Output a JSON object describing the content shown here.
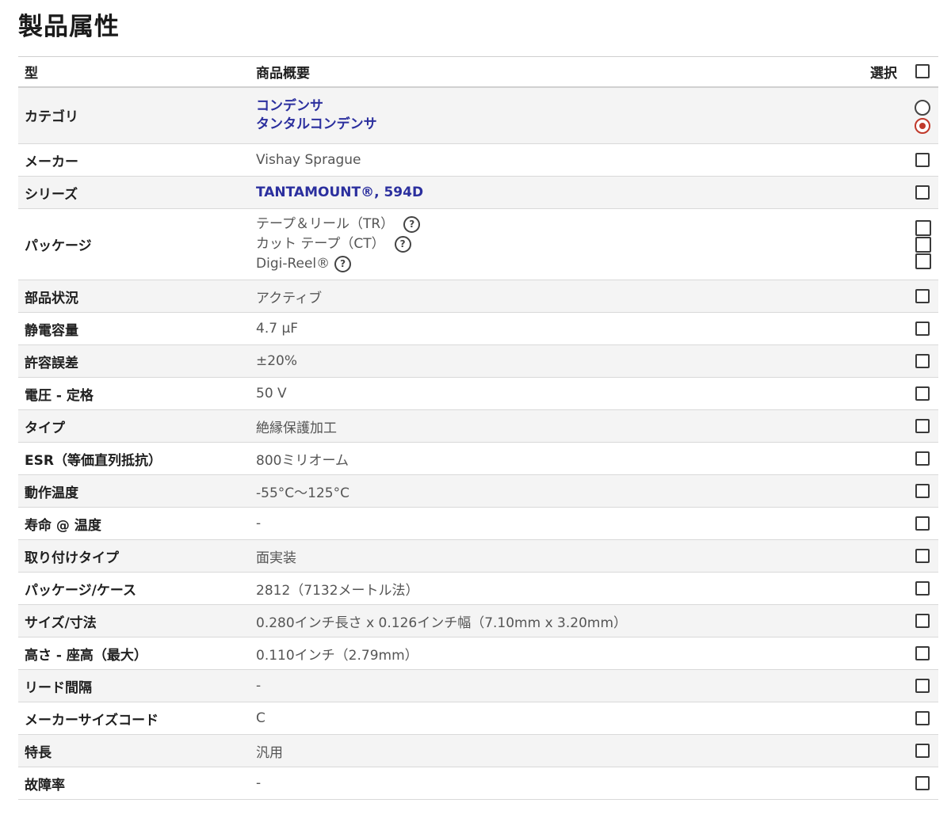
{
  "title": "製品属性",
  "header": {
    "type": "型",
    "summary": "商品概要",
    "select": "選択"
  },
  "category": {
    "label": "カテゴリ",
    "values": [
      "コンデンサ",
      "タンタルコンデンサ"
    ]
  },
  "maker": {
    "label": "メーカー",
    "value": "Vishay Sprague"
  },
  "series": {
    "label": "シリーズ",
    "value": "TANTAMOUNT®, 594D"
  },
  "package": {
    "label": "パッケージ",
    "values": [
      "テープ＆リール（TR）",
      "カット テープ（CT）",
      "Digi-Reel®"
    ],
    "help": "?"
  },
  "rows": [
    {
      "label": "部品状況",
      "value": "アクティブ"
    },
    {
      "label": "静電容量",
      "value": "4.7 µF"
    },
    {
      "label": "許容誤差",
      "value": "±20%"
    },
    {
      "label": "電圧 - 定格",
      "value": "50 V"
    },
    {
      "label": "タイプ",
      "value": "絶縁保護加工"
    },
    {
      "label": "ESR（等価直列抵抗）",
      "value": "800ミリオーム"
    },
    {
      "label": "動作温度",
      "value": "-55°C～125°C"
    },
    {
      "label": "寿命 @ 温度",
      "value": "-"
    },
    {
      "label": "取り付けタイプ",
      "value": "面実装"
    },
    {
      "label": "パッケージ/ケース",
      "value": "2812（7132メートル法）"
    },
    {
      "label": "サイズ/寸法",
      "value": "0.280インチ長さ x 0.126インチ幅（7.10mm x 3.20mm）"
    },
    {
      "label": "高さ - 座高（最大）",
      "value": "0.110インチ（2.79mm）"
    },
    {
      "label": "リード間隔",
      "value": "-"
    },
    {
      "label": "メーカーサイズコード",
      "value": "C"
    },
    {
      "label": "特長",
      "value": "汎用"
    },
    {
      "label": "故障率",
      "value": "-"
    }
  ]
}
